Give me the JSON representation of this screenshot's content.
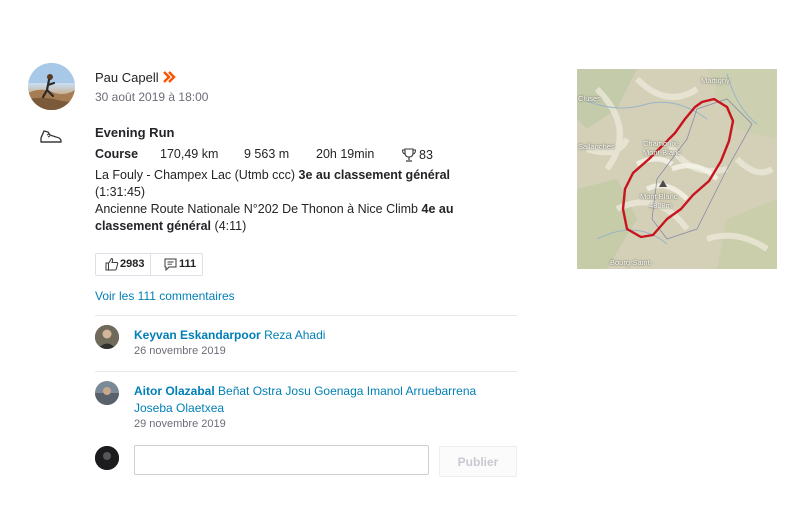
{
  "athlete": {
    "name": "Pau Capell",
    "timestamp": "30 août 2019 à 18:00"
  },
  "activity": {
    "title": "Evening Run",
    "type": "Course",
    "distance": "170,49 km",
    "elevation": "9 563 m",
    "moving_time": "20h 19min",
    "achievements": "83",
    "segments": [
      {
        "name": "La Fouly - Champex Lac (Utmb ccc)",
        "rank": "3e au classement général",
        "time": "(1:31:45)"
      },
      {
        "name": "Ancienne Route Nationale N°202 De Thonon à Nice Climb",
        "rank": "4e au classement général",
        "time": "(4:11)"
      }
    ]
  },
  "social": {
    "kudos_count": "2983",
    "comment_count": "111",
    "view_comments_label": "Voir les 111 commentaires"
  },
  "comments": [
    {
      "author": "Keyvan Eskandarpoor",
      "text": "Reza Ahadi",
      "date": "26 novembre 2019"
    },
    {
      "author": "Aitor Olazabal",
      "text": "Beñat Ostra Josu Goenaga Imanol Arruebarrena Joseba Olaetxea",
      "date": "29 novembre 2019"
    }
  ],
  "comment_form": {
    "placeholder": "",
    "publish_label": "Publier"
  },
  "map": {
    "labels": [
      "Martigny",
      "Cluses",
      "Sallanches",
      "Chamonix-Mont-Blanc",
      "Mont Blanc",
      "4808m",
      "Bourg-Saint-"
    ],
    "route_color": "#c8141e"
  },
  "colors": {
    "link": "#007fb6",
    "premium": "#fc5200",
    "text": "#242428",
    "muted": "#6d6d78"
  },
  "icons": [
    "shoe-icon",
    "premium-chevron-icon",
    "trophy-icon",
    "thumbs-up-icon",
    "comment-icon"
  ]
}
